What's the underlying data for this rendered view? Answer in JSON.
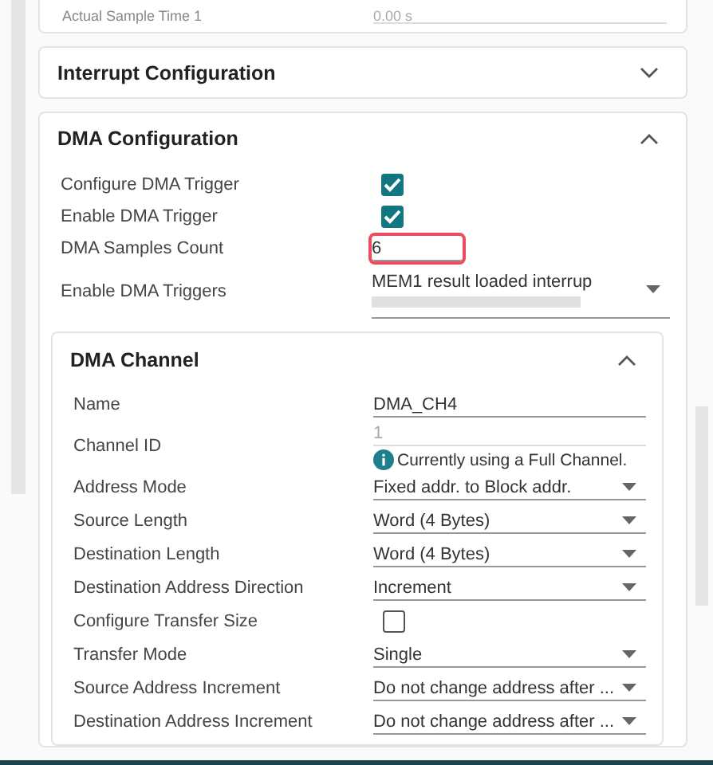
{
  "top_row": {
    "label": "Actual Sample Time 1",
    "value": "0.00 s"
  },
  "sections": [
    {
      "title": "Interrupt Configuration",
      "expanded": false
    },
    {
      "title": "DMA Configuration",
      "expanded": true,
      "fields": [
        {
          "kind": "checkbox",
          "label": "Configure DMA Trigger",
          "checked": true
        },
        {
          "kind": "checkbox",
          "label": "Enable DMA Trigger",
          "checked": true
        },
        {
          "kind": "text",
          "label": "DMA Samples Count",
          "value": "6",
          "highlighted": true
        },
        {
          "kind": "multiselect",
          "label": "Enable DMA Triggers",
          "value": "MEM1 result loaded interrup"
        }
      ],
      "subsection": {
        "title": "DMA Channel",
        "expanded": true,
        "fields": [
          {
            "kind": "text",
            "label": "Name",
            "value": "DMA_CH4",
            "highlighted": false
          },
          {
            "kind": "readonly",
            "label": "Channel ID",
            "value": "1",
            "note": "Currently using a Full Channel."
          },
          {
            "kind": "select",
            "label": "Address Mode",
            "value": "Fixed addr. to Block addr."
          },
          {
            "kind": "select",
            "label": "Source Length",
            "value": "Word (4 Bytes)"
          },
          {
            "kind": "select",
            "label": "Destination Length",
            "value": "Word (4 Bytes)"
          },
          {
            "kind": "select",
            "label": "Destination Address Direction",
            "value": "Increment"
          },
          {
            "kind": "checkbox",
            "label": "Configure Transfer Size",
            "checked": false
          },
          {
            "kind": "select",
            "label": "Transfer Mode",
            "value": "Single"
          },
          {
            "kind": "select",
            "label": "Source Address Increment",
            "value": "Do not change address after ..."
          },
          {
            "kind": "select",
            "label": "Destination Address Increment",
            "value": "Do not change address after ..."
          }
        ]
      }
    }
  ]
}
